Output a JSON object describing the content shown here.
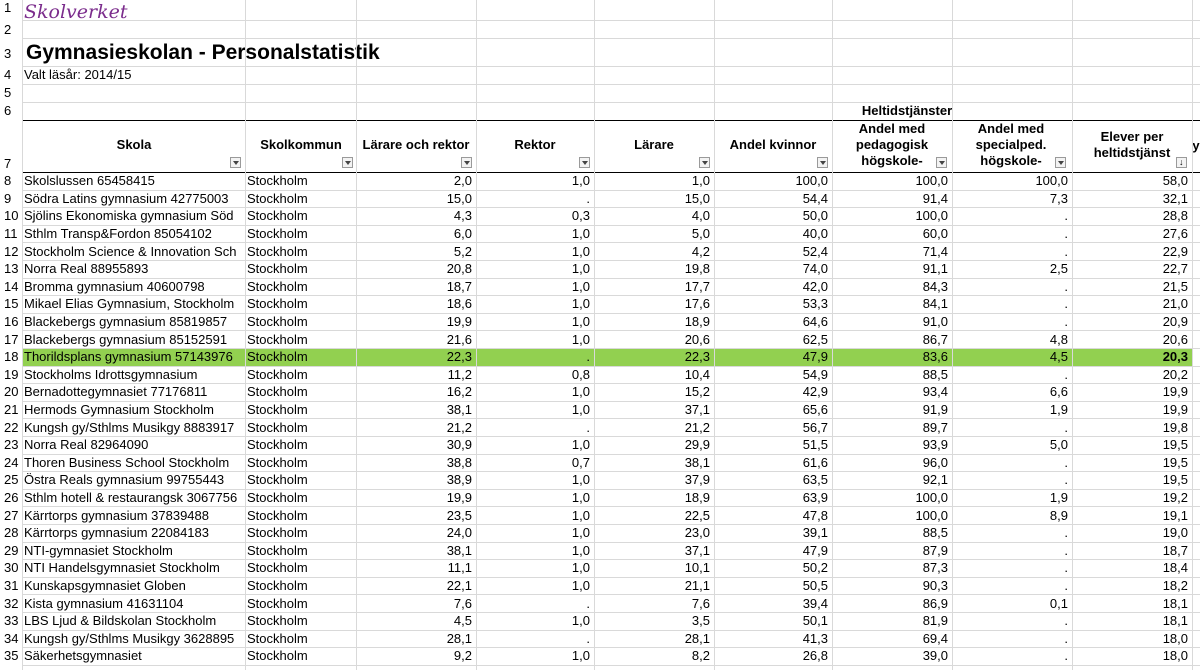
{
  "sheet": {
    "logo": "Skolverket",
    "title": "Gymnasieskolan - Personalstatistik",
    "subtitle": "Valt läsår: 2014/15",
    "group_header": "Heltidstjänster",
    "cut_header": "y"
  },
  "columns": [
    {
      "label": "Skola"
    },
    {
      "label": "Skolkommun"
    },
    {
      "label": "Lärare och rektor"
    },
    {
      "label": "Rektor"
    },
    {
      "label": "Lärare"
    },
    {
      "label": "Andel kvinnor"
    },
    {
      "label": "Andel med pedagogisk högskole-"
    },
    {
      "label": "Andel med specialped. högskole-"
    },
    {
      "label": "Elever per heltidstjänst"
    }
  ],
  "row_numbers": [
    "1",
    "2",
    "3",
    "4",
    "5",
    "6",
    "7"
  ],
  "rows": [
    {
      "n": "8",
      "school": "Skolslussen 65458415",
      "kommun": "Stockholm",
      "lr": "2,0",
      "rektor": "1,0",
      "larare": "1,0",
      "kvinnor": "100,0",
      "ped": "100,0",
      "sped": "100,0",
      "elever": "58,0"
    },
    {
      "n": "9",
      "school": "Södra Latins gymnasium 42775003",
      "kommun": "Stockholm",
      "lr": "15,0",
      "rektor": ".",
      "larare": "15,0",
      "kvinnor": "54,4",
      "ped": "91,4",
      "sped": "7,3",
      "elever": "32,1"
    },
    {
      "n": "10",
      "school": "Sjölins Ekonomiska gymnasium Söd",
      "kommun": "Stockholm",
      "lr": "4,3",
      "rektor": "0,3",
      "larare": "4,0",
      "kvinnor": "50,0",
      "ped": "100,0",
      "sped": ".",
      "elever": "28,8"
    },
    {
      "n": "11",
      "school": "Sthlm Transp&Fordon 85054102",
      "kommun": "Stockholm",
      "lr": "6,0",
      "rektor": "1,0",
      "larare": "5,0",
      "kvinnor": "40,0",
      "ped": "60,0",
      "sped": ".",
      "elever": "27,6"
    },
    {
      "n": "12",
      "school": "Stockholm Science & Innovation Sch",
      "kommun": "Stockholm",
      "lr": "5,2",
      "rektor": "1,0",
      "larare": "4,2",
      "kvinnor": "52,4",
      "ped": "71,4",
      "sped": ".",
      "elever": "22,9"
    },
    {
      "n": "13",
      "school": "Norra Real 88955893",
      "kommun": "Stockholm",
      "lr": "20,8",
      "rektor": "1,0",
      "larare": "19,8",
      "kvinnor": "74,0",
      "ped": "91,1",
      "sped": "2,5",
      "elever": "22,7"
    },
    {
      "n": "14",
      "school": "Bromma gymnasium 40600798",
      "kommun": "Stockholm",
      "lr": "18,7",
      "rektor": "1,0",
      "larare": "17,7",
      "kvinnor": "42,0",
      "ped": "84,3",
      "sped": ".",
      "elever": "21,5"
    },
    {
      "n": "15",
      "school": "Mikael Elias Gymnasium, Stockholm",
      "kommun": "Stockholm",
      "lr": "18,6",
      "rektor": "1,0",
      "larare": "17,6",
      "kvinnor": "53,3",
      "ped": "84,1",
      "sped": ".",
      "elever": "21,0"
    },
    {
      "n": "16",
      "school": "Blackebergs gymnasium 85819857",
      "kommun": "Stockholm",
      "lr": "19,9",
      "rektor": "1,0",
      "larare": "18,9",
      "kvinnor": "64,6",
      "ped": "91,0",
      "sped": ".",
      "elever": "20,9"
    },
    {
      "n": "17",
      "school": "Blackebergs gymnasium 85152591",
      "kommun": "Stockholm",
      "lr": "21,6",
      "rektor": "1,0",
      "larare": "20,6",
      "kvinnor": "62,5",
      "ped": "86,7",
      "sped": "4,8",
      "elever": "20,6"
    },
    {
      "n": "18",
      "school": "Thorildsplans gymnasium 57143976",
      "kommun": "Stockholm",
      "lr": "22,3",
      "rektor": ".",
      "larare": "22,3",
      "kvinnor": "47,9",
      "ped": "83,6",
      "sped": "4,5",
      "elever": "20,3",
      "highlight": true
    },
    {
      "n": "19",
      "school": "Stockholms Idrottsgymnasium",
      "kommun": "Stockholm",
      "lr": "11,2",
      "rektor": "0,8",
      "larare": "10,4",
      "kvinnor": "54,9",
      "ped": "88,5",
      "sped": ".",
      "elever": "20,2"
    },
    {
      "n": "20",
      "school": "Bernadottegymnasiet 77176811",
      "kommun": "Stockholm",
      "lr": "16,2",
      "rektor": "1,0",
      "larare": "15,2",
      "kvinnor": "42,9",
      "ped": "93,4",
      "sped": "6,6",
      "elever": "19,9"
    },
    {
      "n": "21",
      "school": "Hermods Gymnasium Stockholm",
      "kommun": "Stockholm",
      "lr": "38,1",
      "rektor": "1,0",
      "larare": "37,1",
      "kvinnor": "65,6",
      "ped": "91,9",
      "sped": "1,9",
      "elever": "19,9"
    },
    {
      "n": "22",
      "school": "Kungsh gy/Sthlms Musikgy 8883917",
      "kommun": "Stockholm",
      "lr": "21,2",
      "rektor": ".",
      "larare": "21,2",
      "kvinnor": "56,7",
      "ped": "89,7",
      "sped": ".",
      "elever": "19,8"
    },
    {
      "n": "23",
      "school": "Norra Real 82964090",
      "kommun": "Stockholm",
      "lr": "30,9",
      "rektor": "1,0",
      "larare": "29,9",
      "kvinnor": "51,5",
      "ped": "93,9",
      "sped": "5,0",
      "elever": "19,5"
    },
    {
      "n": "24",
      "school": "Thoren Business School Stockholm",
      "kommun": "Stockholm",
      "lr": "38,8",
      "rektor": "0,7",
      "larare": "38,1",
      "kvinnor": "61,6",
      "ped": "96,0",
      "sped": ".",
      "elever": "19,5"
    },
    {
      "n": "25",
      "school": "Östra Reals gymnasium 99755443",
      "kommun": "Stockholm",
      "lr": "38,9",
      "rektor": "1,0",
      "larare": "37,9",
      "kvinnor": "63,5",
      "ped": "92,1",
      "sped": ".",
      "elever": "19,5"
    },
    {
      "n": "26",
      "school": "Sthlm hotell & restaurangsk 3067756",
      "kommun": "Stockholm",
      "lr": "19,9",
      "rektor": "1,0",
      "larare": "18,9",
      "kvinnor": "63,9",
      "ped": "100,0",
      "sped": "1,9",
      "elever": "19,2"
    },
    {
      "n": "27",
      "school": "Kärrtorps gymnasium 37839488",
      "kommun": "Stockholm",
      "lr": "23,5",
      "rektor": "1,0",
      "larare": "22,5",
      "kvinnor": "47,8",
      "ped": "100,0",
      "sped": "8,9",
      "elever": "19,1"
    },
    {
      "n": "28",
      "school": "Kärrtorps gymnasium 22084183",
      "kommun": "Stockholm",
      "lr": "24,0",
      "rektor": "1,0",
      "larare": "23,0",
      "kvinnor": "39,1",
      "ped": "88,5",
      "sped": ".",
      "elever": "19,0"
    },
    {
      "n": "29",
      "school": "NTI-gymnasiet Stockholm",
      "kommun": "Stockholm",
      "lr": "38,1",
      "rektor": "1,0",
      "larare": "37,1",
      "kvinnor": "47,9",
      "ped": "87,9",
      "sped": ".",
      "elever": "18,7"
    },
    {
      "n": "30",
      "school": "NTI Handelsgymnasiet Stockholm",
      "kommun": "Stockholm",
      "lr": "11,1",
      "rektor": "1,0",
      "larare": "10,1",
      "kvinnor": "50,2",
      "ped": "87,3",
      "sped": ".",
      "elever": "18,4"
    },
    {
      "n": "31",
      "school": "Kunskapsgymnasiet Globen",
      "kommun": "Stockholm",
      "lr": "22,1",
      "rektor": "1,0",
      "larare": "21,1",
      "kvinnor": "50,5",
      "ped": "90,3",
      "sped": ".",
      "elever": "18,2"
    },
    {
      "n": "32",
      "school": "Kista gymnasium 41631104",
      "kommun": "Stockholm",
      "lr": "7,6",
      "rektor": ".",
      "larare": "7,6",
      "kvinnor": "39,4",
      "ped": "86,9",
      "sped": "0,1",
      "elever": "18,1"
    },
    {
      "n": "33",
      "school": "LBS Ljud & Bildskolan Stockholm",
      "kommun": "Stockholm",
      "lr": "4,5",
      "rektor": "1,0",
      "larare": "3,5",
      "kvinnor": "50,1",
      "ped": "81,9",
      "sped": ".",
      "elever": "18,1"
    },
    {
      "n": "34",
      "school": "Kungsh gy/Sthlms Musikgy 3628895",
      "kommun": "Stockholm",
      "lr": "28,1",
      "rektor": ".",
      "larare": "28,1",
      "kvinnor": "41,3",
      "ped": "69,4",
      "sped": ".",
      "elever": "18,0"
    },
    {
      "n": "35",
      "school": "Säkerhetsgymnasiet",
      "kommun": "Stockholm",
      "lr": "9,2",
      "rektor": "1,0",
      "larare": "8,2",
      "kvinnor": "26,8",
      "ped": "39,0",
      "sped": ".",
      "elever": "18,0"
    }
  ]
}
